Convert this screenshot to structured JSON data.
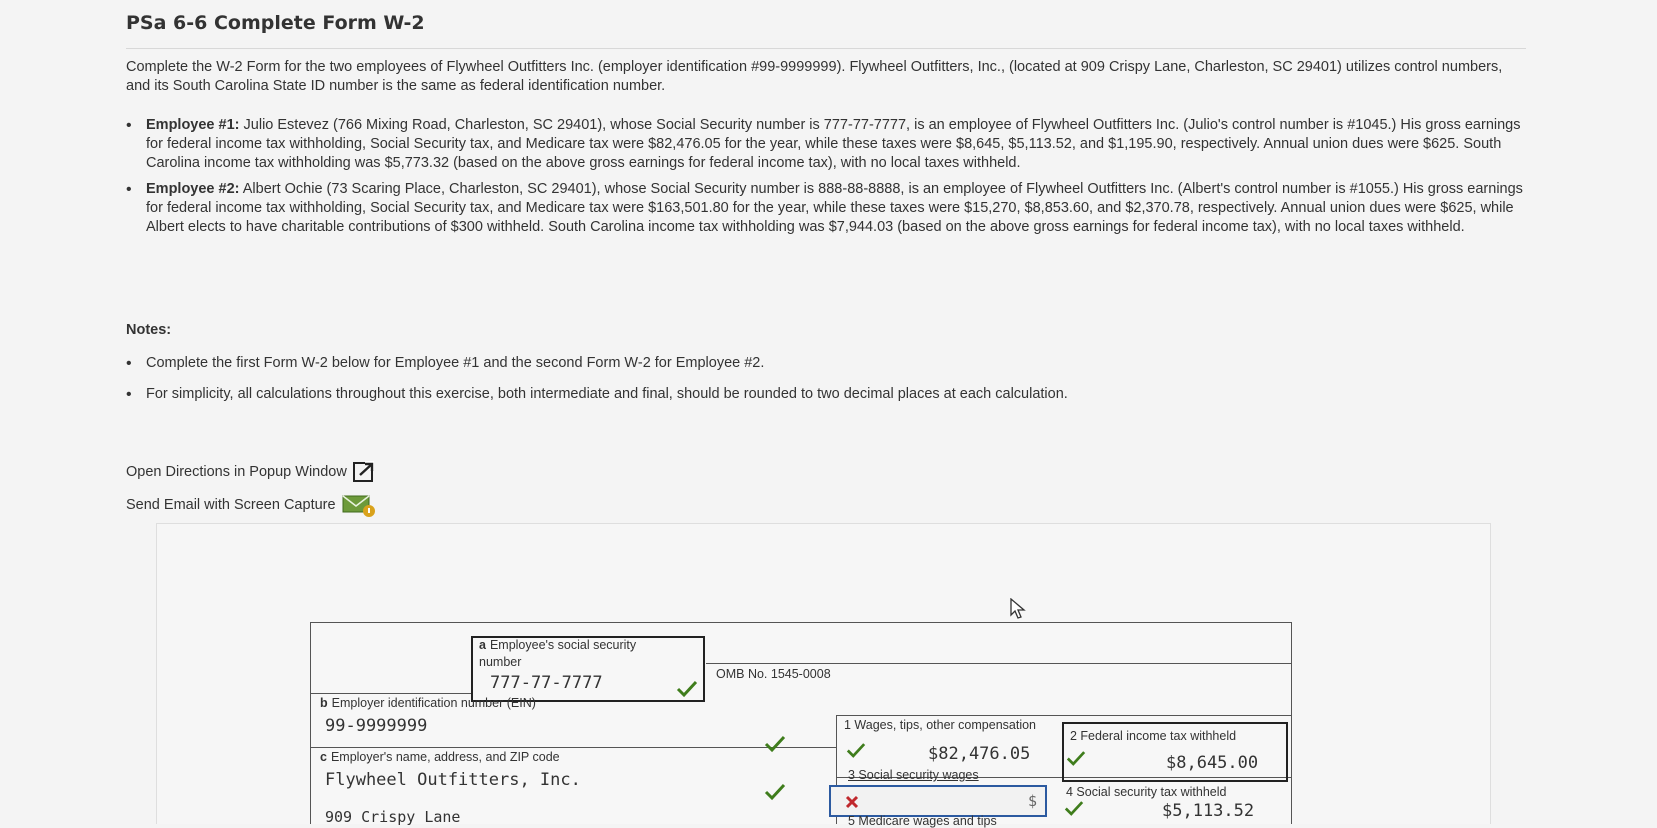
{
  "title": "PSa 6-6 Complete Form W-2",
  "intro": "Complete the W-2 Form for the two employees of Flywheel Outfitters Inc. (employer identification #99-9999999). Flywheel Outfitters, Inc., (located at 909 Crispy Lane, Charleston, SC 29401) utilizes control numbers, and its South Carolina State ID number is the same as federal identification number.",
  "employees": [
    {
      "label": "Employee #1:",
      "text": "Julio Estevez (766 Mixing Road, Charleston, SC 29401), whose Social Security number is 777-77-7777, is an employee of Flywheel Outfitters Inc. (Julio's control number is #1045.) His gross earnings for federal income tax withholding, Social Security tax, and Medicare tax were $82,476.05 for the year, while these taxes were $8,645, $5,113.52, and $1,195.90, respectively. Annual union dues were $625. South Carolina income tax withholding was $5,773.32 (based on the above gross earnings for federal income tax), with no local taxes withheld."
    },
    {
      "label": "Employee #2:",
      "text": "Albert Ochie (73 Scaring Place, Charleston, SC 29401), whose Social Security number is 888-88-8888, is an employee of Flywheel Outfitters Inc. (Albert's control number is #1055.) His gross earnings for federal income tax withholding, Social Security tax, and Medicare tax were $163,501.80 for the year, while these taxes were $15,270, $8,853.60, and $2,370.78, respectively. Annual union dues were $625, while Albert elects to have charitable contributions of $300 withheld. South Carolina income tax withholding was $7,944.03 (based on the above gross earnings for federal income tax), with no local taxes withheld."
    }
  ],
  "notes_label": "Notes:",
  "notes": [
    "Complete the first Form W-2 below for Employee #1 and the second Form W-2 for Employee #2.",
    "For simplicity, all calculations throughout this exercise, both intermediate and final, should be rounded to two decimal places at each calculation."
  ],
  "links": {
    "popup": "Open Directions in Popup Window",
    "email": "Send Email with Screen Capture"
  },
  "w2": {
    "a_letter": "a",
    "a_label_1": "Employee's social security",
    "a_label_2": "number",
    "a_value": "777-77-7777",
    "omb": "OMB No. 1545-0008",
    "b_letter": "b",
    "b_label": "Employer identification number (EIN)",
    "b_value": "99-9999999",
    "c_letter": "c",
    "c_label": "Employer's name, address, and ZIP code",
    "c_value_1": "Flywheel Outfitters, Inc.",
    "c_value_2": "909 Crispy Lane",
    "box1_label": "1 Wages, tips, other compensation",
    "box1_value": "$82,476.05",
    "box2_label": "2 Federal income tax withheld",
    "box2_value": "$8,645.00",
    "box3_label": "3 Social security wages",
    "box3_value": "$",
    "box4_label": "4 Social security tax withheld",
    "box4_value": "$5,113.52",
    "box5_label": "5 Medicare wages and tips"
  },
  "colors": {
    "check": "#3f7d1c",
    "cross": "#c0282d",
    "active_border": "#2c5aa0",
    "mail_badge": "#d9a21b"
  },
  "icons": [
    "popup-window-icon",
    "email-icon",
    "check-icon",
    "cross-icon",
    "mouse-cursor-icon"
  ]
}
